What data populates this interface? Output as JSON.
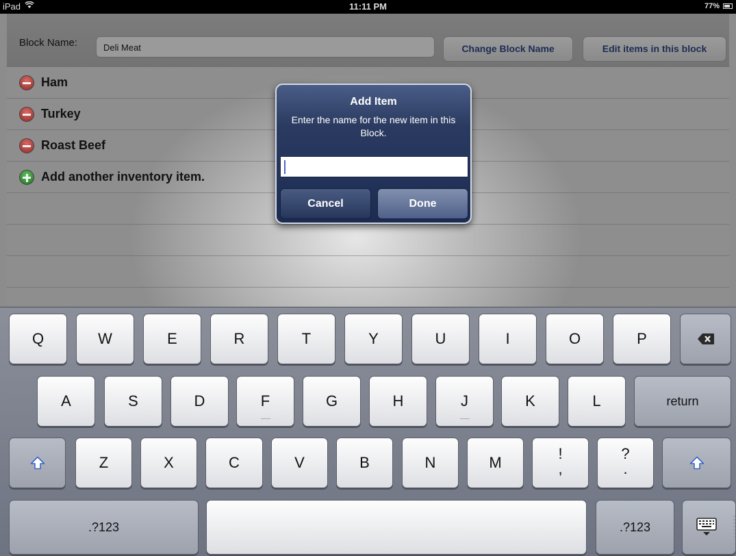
{
  "status": {
    "device": "iPad",
    "time": "11:11 PM",
    "battery": "77%",
    "battery_level": 0.77
  },
  "header": {
    "block_label": "Block Name:",
    "block_name_value": "Deli Meat",
    "change_button": "Change Block Name",
    "edit_button": "Edit items in this block"
  },
  "list": {
    "items": [
      {
        "label": "Ham",
        "action": "delete"
      },
      {
        "label": "Turkey",
        "action": "delete"
      },
      {
        "label": "Roast Beef",
        "action": "delete"
      },
      {
        "label": "Add another inventory item.",
        "action": "add"
      }
    ]
  },
  "alert": {
    "title": "Add Item",
    "message": "Enter the name for the new item in this Block.",
    "input_value": "",
    "cancel": "Cancel",
    "done": "Done"
  },
  "keyboard": {
    "row1": [
      "Q",
      "W",
      "E",
      "R",
      "T",
      "Y",
      "U",
      "I",
      "O",
      "P"
    ],
    "row2": [
      "A",
      "S",
      "D",
      "F",
      "G",
      "H",
      "J",
      "K",
      "L"
    ],
    "row3": [
      "Z",
      "X",
      "C",
      "V",
      "B",
      "N",
      "M"
    ],
    "return_label": "return",
    "numbers_label": ".?123",
    "punct1_top": "!",
    "punct1_bottom": ",",
    "punct2_top": "?",
    "punct2_bottom": "."
  },
  "colors": {
    "alert_bg": "#1c2b52",
    "button_text": "#1c2c52",
    "delete_badge": "#c0392b",
    "add_badge": "#2e8b2e"
  }
}
